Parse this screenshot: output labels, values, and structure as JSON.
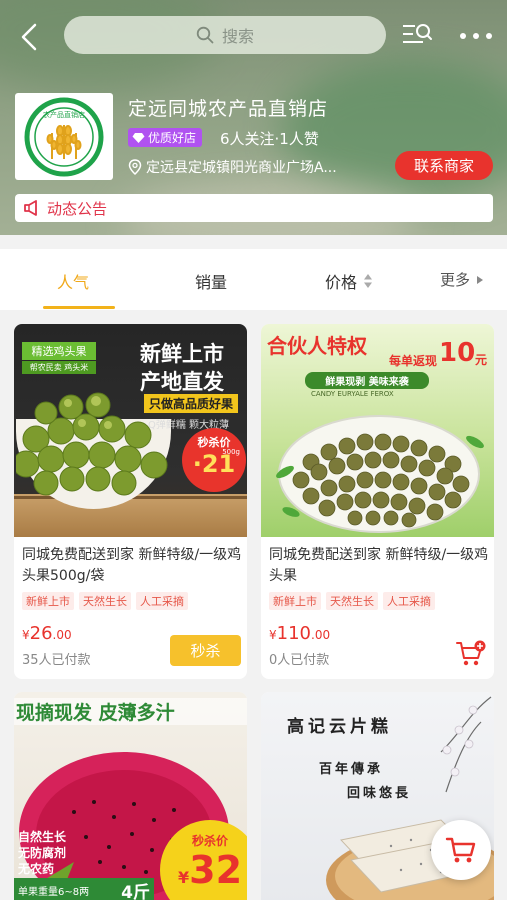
{
  "header": {
    "search_placeholder": "搜索",
    "store_name": "定远同城农产品直销店",
    "badge": "优质好店",
    "follow_text": "6人关注·1人赞",
    "address": "定远县定城镇阳光商业广场A...",
    "contact_button": "联系商家",
    "notice": "动态公告",
    "logo_text": "农产品直销店"
  },
  "tabs": [
    {
      "label": "人气",
      "active": true
    },
    {
      "label": "销量"
    },
    {
      "label": "价格"
    },
    {
      "label": "更多"
    }
  ],
  "products": [
    {
      "title": "同城免费配送到家 新鲜特级/一级鸡头果500g/袋",
      "tags": [
        "新鲜上市",
        "天然生长",
        "人工采摘"
      ],
      "price_symbol": "¥",
      "price_int": "26",
      "price_dec": ".00",
      "paid": "35人已付款",
      "action": "秒杀",
      "image_text": {
        "corner": "精选鸡头果",
        "corner_sub": "帮农民卖 鸡头米",
        "headline1": "新鲜上市",
        "headline2": "产地直发",
        "banner": "只做高品质好果",
        "sub": "Q弹鲜糯 颗大粒薄",
        "price_label": "秒杀价",
        "price_unit": "500g",
        "price": "21"
      }
    },
    {
      "title": "同城免费配送到家 新鲜特级/一级鸡头果",
      "tags": [
        "新鲜上市",
        "天然生长",
        "人工采摘"
      ],
      "price_symbol": "¥",
      "price_int": "110",
      "price_dec": ".00",
      "paid": "0人已付款",
      "image_text": {
        "headline": "合伙人特权",
        "sub": "每单返现",
        "amount": "10",
        "unit": "元",
        "banner": "鲜果现剥 美味来袭",
        "latin": "CANDY EURYALE FEROX"
      }
    },
    {
      "image_text": {
        "headline": "现摘现发 皮薄多汁",
        "side1": "自然生长",
        "side2": "无防腐剂",
        "side3": "无农药",
        "bottom_left": "单果重量6~8两",
        "bottom_right": "4斤",
        "price_label": "秒杀价",
        "price": "32",
        "currency": "¥"
      }
    },
    {
      "image_text": {
        "headline": "高记云片糕",
        "line1": "百年傳承",
        "line2": "回味悠長"
      }
    }
  ],
  "colors": {
    "accent": "#f2b21a",
    "price": "#e8332d",
    "badge": "#b052f0",
    "notice": "#e0344a"
  }
}
